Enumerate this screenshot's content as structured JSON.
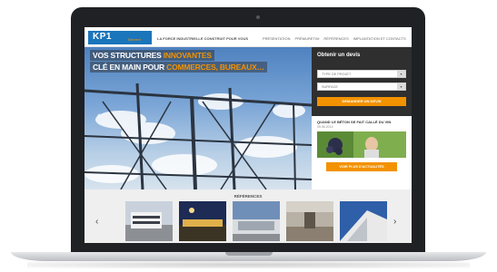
{
  "site": {
    "logo_text": "KP1",
    "logo_sub": "Bâtiment",
    "tagline": "LA FORCE INDUSTRIELLE CONSTRUIT POUR VOUS",
    "nav": [
      "PRÉSENTATION",
      "PRÉMURETIM",
      "RÉFÉRENCES",
      "IMPLANTATION ET CONTACTS"
    ]
  },
  "hero": {
    "line1_prefix": "VOS STRUCTURES ",
    "line1_highlight": "INNOVANTES",
    "line2_prefix": "CLÉ EN MAIN POUR ",
    "line2_highlight": "COMMERCES, BUREAUX…",
    "prev_arrow": "‹",
    "next_arrow": "›"
  },
  "devis": {
    "title": "Obtenir un devis",
    "select1": "TYPE DE PROJET",
    "select2": "SURFACE",
    "select_arrow": "▾",
    "button": "DEMANDER UN DEVIS"
  },
  "news": {
    "title": "QUAND LE BÉTON SE FAIT CALLÉ DU VIN",
    "date": "05.06.2014",
    "button": "VOIR PLUS D'ACTUALITÉS"
  },
  "references": {
    "title": "RÉFÉRENCES",
    "prev_arrow": "‹",
    "next_arrow": "›"
  },
  "colors": {
    "brand_blue": "#1b75bb",
    "accent_orange": "#f39200",
    "panel_dark": "#2f2f2f"
  }
}
